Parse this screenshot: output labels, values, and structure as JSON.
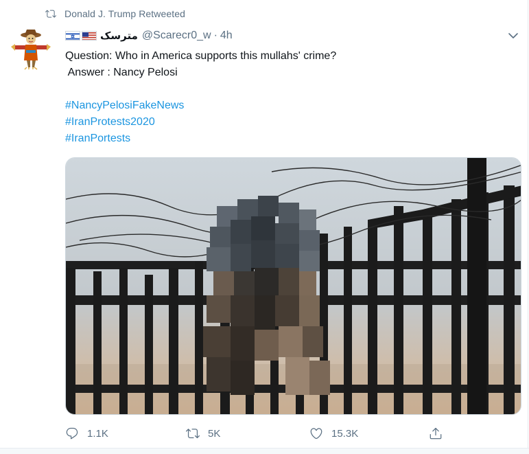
{
  "retweet_context": {
    "text": "Donald J. Trump Retweeted",
    "icon": "retweet-icon"
  },
  "author": {
    "flags": [
      "flag-israel",
      "flag-usa"
    ],
    "display_name": "مترسک",
    "handle": "@Scarecr0_w",
    "separator": "·",
    "time": "4h"
  },
  "tweet": {
    "line1": "Question: Who in America supports this mullahs' crime?",
    "line2": " Answer : Nancy Pelosi",
    "hashtags": [
      "#NancyPelosiFakeNews",
      "#IranProtests2020",
      "#IranPortests"
    ]
  },
  "actions": {
    "reply_count": "1.1K",
    "retweet_count": "5K",
    "like_count": "15.3K"
  },
  "colors": {
    "link": "#1b95e0",
    "muted": "#5b7083",
    "text": "#0f1419"
  }
}
